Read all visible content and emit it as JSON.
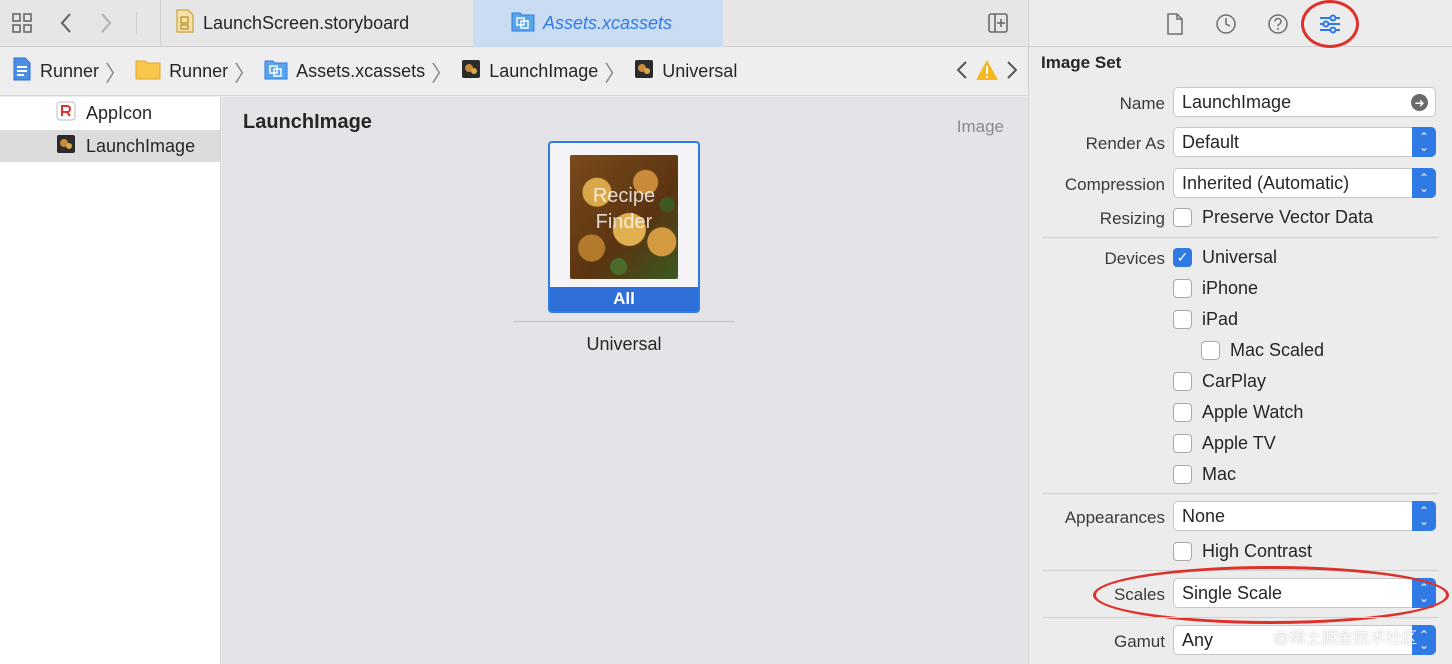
{
  "tabs": [
    {
      "label": "LaunchScreen.storyboard"
    },
    {
      "label": "Assets.xcassets"
    }
  ],
  "breadcrumb": {
    "items": [
      "Runner",
      "Runner",
      "Assets.xcassets",
      "LaunchImage",
      "Universal"
    ]
  },
  "sidebar": {
    "items": [
      {
        "label": "AppIcon"
      },
      {
        "label": "LaunchImage"
      }
    ]
  },
  "editor": {
    "title": "LaunchImage",
    "type_label": "Image",
    "thumbnail_text": [
      "Recipe",
      "Finder"
    ],
    "well_label": "All",
    "slot_label": "Universal"
  },
  "inspector": {
    "heading": "Image Set",
    "name_label": "Name",
    "name_value": "LaunchImage",
    "render_as_label": "Render As",
    "render_as_value": "Default",
    "compression_label": "Compression",
    "compression_value": "Inherited (Automatic)",
    "resizing_label": "Resizing",
    "preserve_vector_label": "Preserve Vector Data",
    "devices_label": "Devices",
    "devices": [
      {
        "label": "Universal",
        "checked": true
      },
      {
        "label": "iPhone",
        "checked": false
      },
      {
        "label": "iPad",
        "checked": false
      },
      {
        "label": "Mac Scaled",
        "checked": false
      },
      {
        "label": "CarPlay",
        "checked": false
      },
      {
        "label": "Apple Watch",
        "checked": false
      },
      {
        "label": "Apple TV",
        "checked": false
      },
      {
        "label": "Mac",
        "checked": false
      }
    ],
    "appearances_label": "Appearances",
    "appearances_value": "None",
    "high_contrast_label": "High Contrast",
    "scales_label": "Scales",
    "scales_value": "Single Scale",
    "gamut_label": "Gamut",
    "gamut_value": "Any"
  },
  "watermark": "@稀土掘金技术社区",
  "colors": {
    "accent": "#2f7ae5",
    "annotation": "#e0302a"
  }
}
